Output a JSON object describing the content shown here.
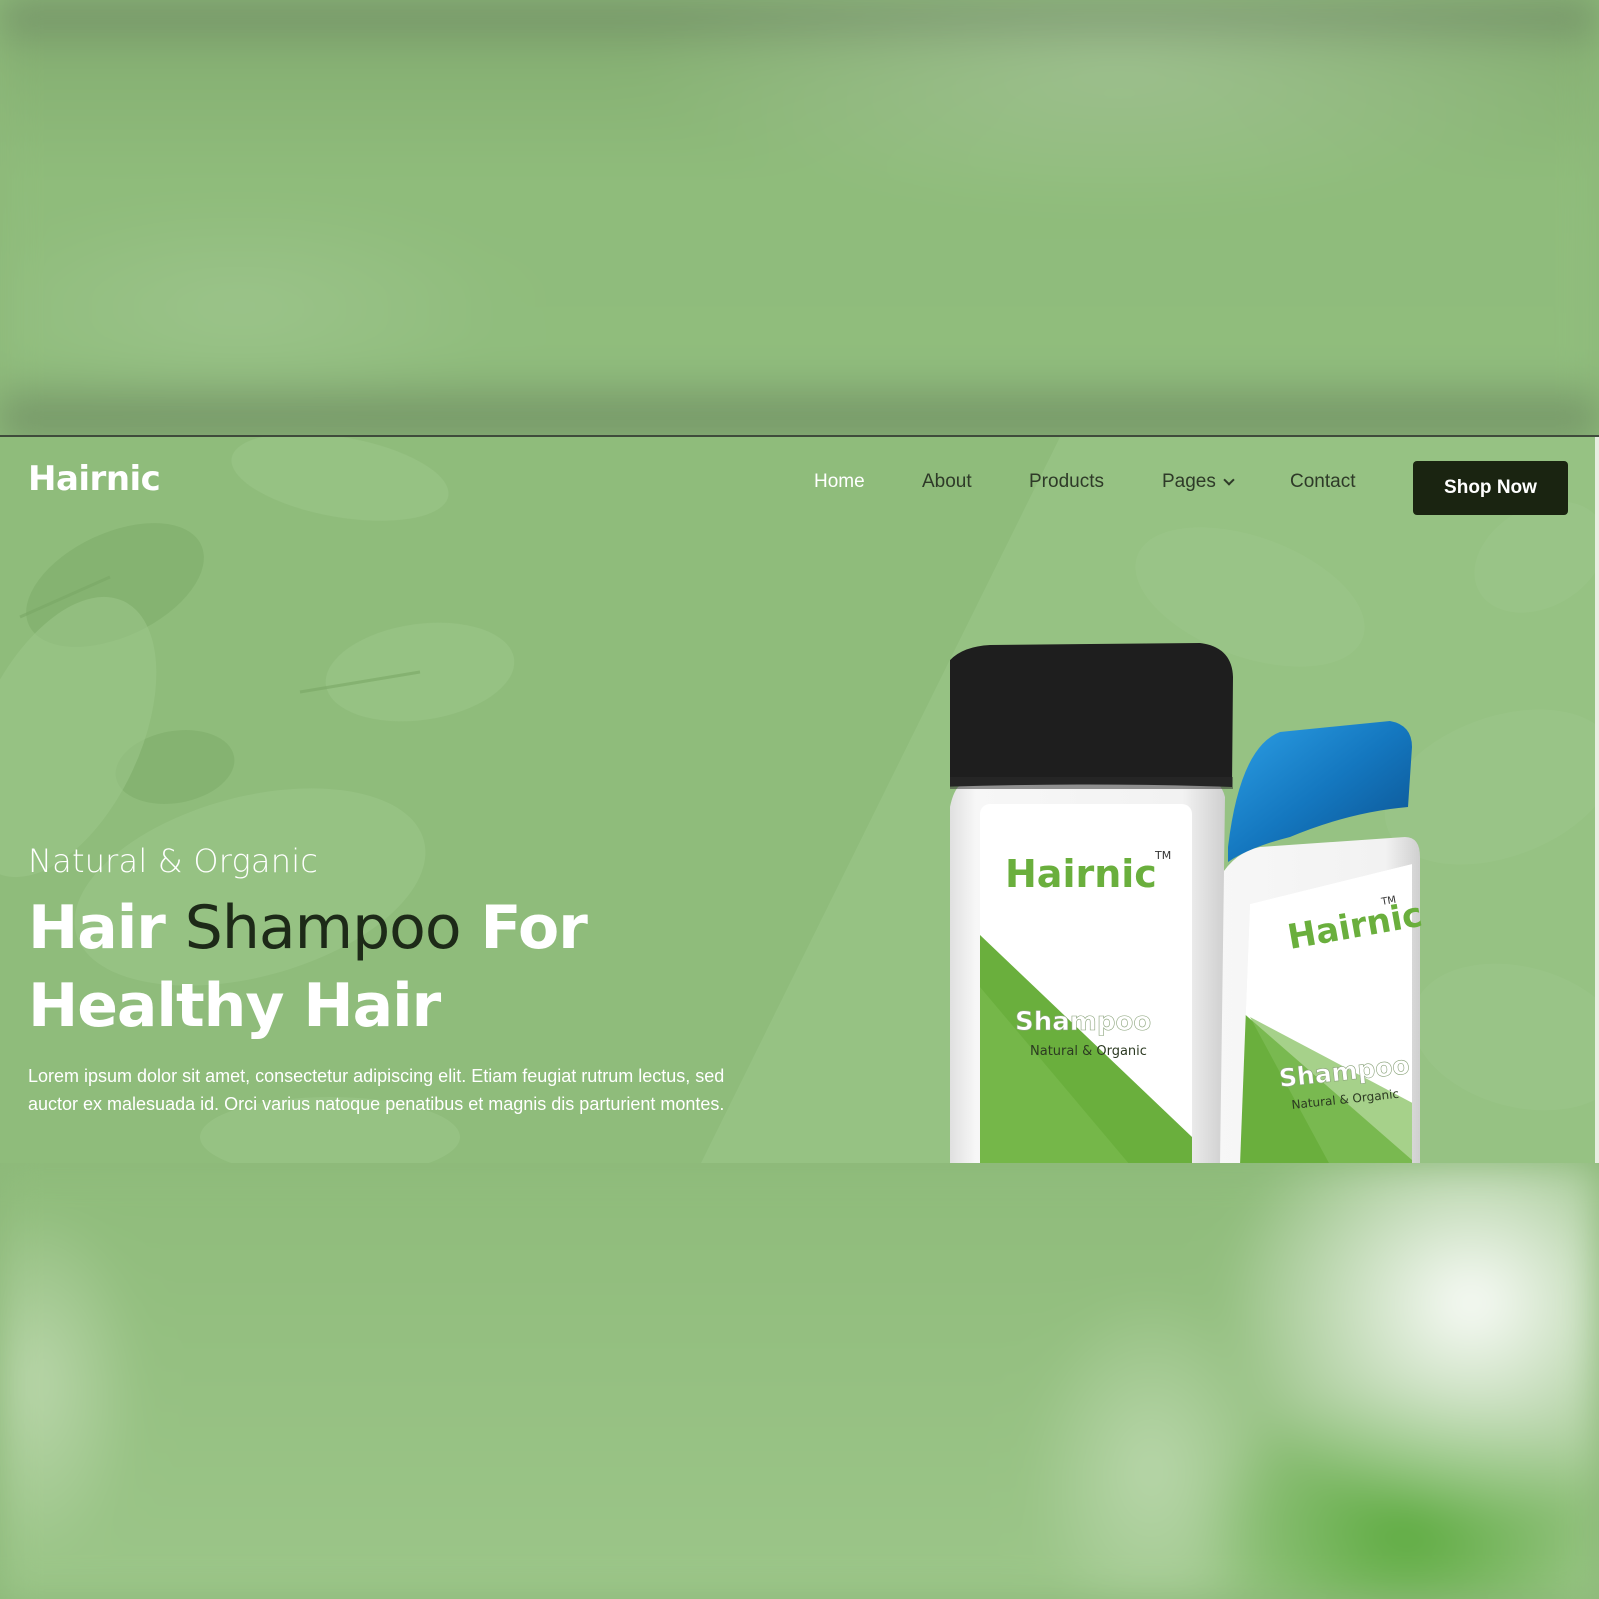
{
  "header": {
    "logo": "Hairnic",
    "nav": [
      {
        "label": "Home",
        "active": true
      },
      {
        "label": "About",
        "active": false
      },
      {
        "label": "Products",
        "active": false
      },
      {
        "label": "Pages",
        "active": false,
        "has_dropdown": true
      },
      {
        "label": "Contact",
        "active": false
      }
    ],
    "cta_label": "Shop Now"
  },
  "hero": {
    "eyebrow": "Natural & Organic",
    "headline": {
      "line1_part1": "Hair",
      "line1_part2": "Shampoo",
      "line1_part3": "For",
      "line2": "Healthy Hair"
    },
    "description": "Lorem ipsum dolor sit amet, consectetur adipiscing elit. Etiam feugiat rutrum lectus, sed auctor ex malesuada id. Orci varius natoque penatibus et magnis dis parturient montes."
  },
  "product": {
    "brand": "Hairnic",
    "trademark": "TM",
    "name": "Shampoo",
    "tagline": "Natural & Organic"
  },
  "colors": {
    "background_green": "#8fbc7b",
    "button_dark": "#1a2411",
    "nav_text": "#2e3a28",
    "bottle_green": "#6aaf3d",
    "cap_black": "#1e1e1e",
    "cap_blue": "#1a7fc4"
  }
}
